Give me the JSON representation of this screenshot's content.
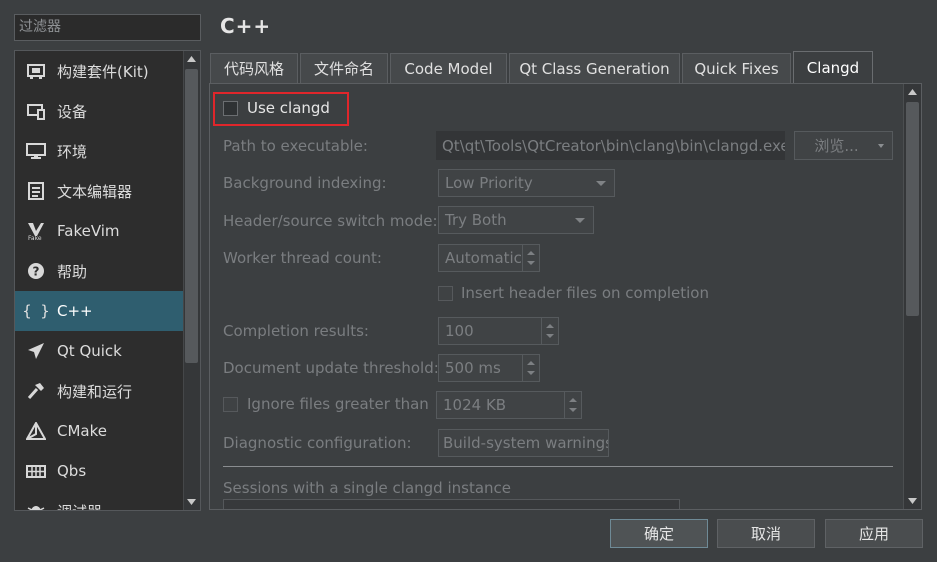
{
  "filter": {
    "placeholder": "过滤器"
  },
  "sidebar": {
    "items": [
      {
        "label": "构建套件(Kit)",
        "icon": "kit-icon"
      },
      {
        "label": "设备",
        "icon": "device-icon"
      },
      {
        "label": "环境",
        "icon": "monitor-icon"
      },
      {
        "label": "文本编辑器",
        "icon": "text-editor-icon"
      },
      {
        "label": "FakeVim",
        "icon": "fakevim-icon"
      },
      {
        "label": "帮助",
        "icon": "help-icon"
      },
      {
        "label": "C++",
        "icon": "braces-icon",
        "active": true
      },
      {
        "label": "Qt Quick",
        "icon": "qtquick-icon"
      },
      {
        "label": "构建和运行",
        "icon": "hammer-icon"
      },
      {
        "label": "CMake",
        "icon": "cmake-icon"
      },
      {
        "label": "Qbs",
        "icon": "qbs-icon"
      },
      {
        "label": "调试器",
        "icon": "debugger-icon"
      }
    ]
  },
  "page": {
    "title": "C++"
  },
  "tabs": [
    "代码风格",
    "文件命名",
    "Code Model",
    "Qt Class Generation",
    "Quick Fixes",
    "Clangd"
  ],
  "active_tab": "Clangd",
  "clangd": {
    "use_clangd": {
      "label": "Use clangd",
      "checked": false
    },
    "path_label": "Path to executable:",
    "path_value": "Qt\\qt\\Tools\\QtCreator\\bin\\clang\\bin\\clangd.exe",
    "browse_label": "浏览...",
    "bg_index_label": "Background indexing:",
    "bg_index_value": "Low Priority",
    "header_switch_label": "Header/source switch mode:",
    "header_switch_value": "Try Both",
    "worker_label": "Worker thread count:",
    "worker_value": "Automatic",
    "insert_header_label": "Insert header files on completion",
    "completion_label": "Completion results:",
    "completion_value": "100",
    "doc_threshold_label": "Document update threshold:",
    "doc_threshold_value": "500 ms",
    "ignore_files_label": "Ignore files greater than",
    "ignore_files_value": "1024 KB",
    "diag_label": "Diagnostic configuration:",
    "diag_value": "Build-system warnings",
    "sessions_label": "Sessions with a single clangd instance"
  },
  "buttons": {
    "ok": "确定",
    "cancel": "取消",
    "apply": "应用"
  },
  "colors": {
    "highlight_box": "#e0262b",
    "active_item": "#2f5e6f"
  }
}
